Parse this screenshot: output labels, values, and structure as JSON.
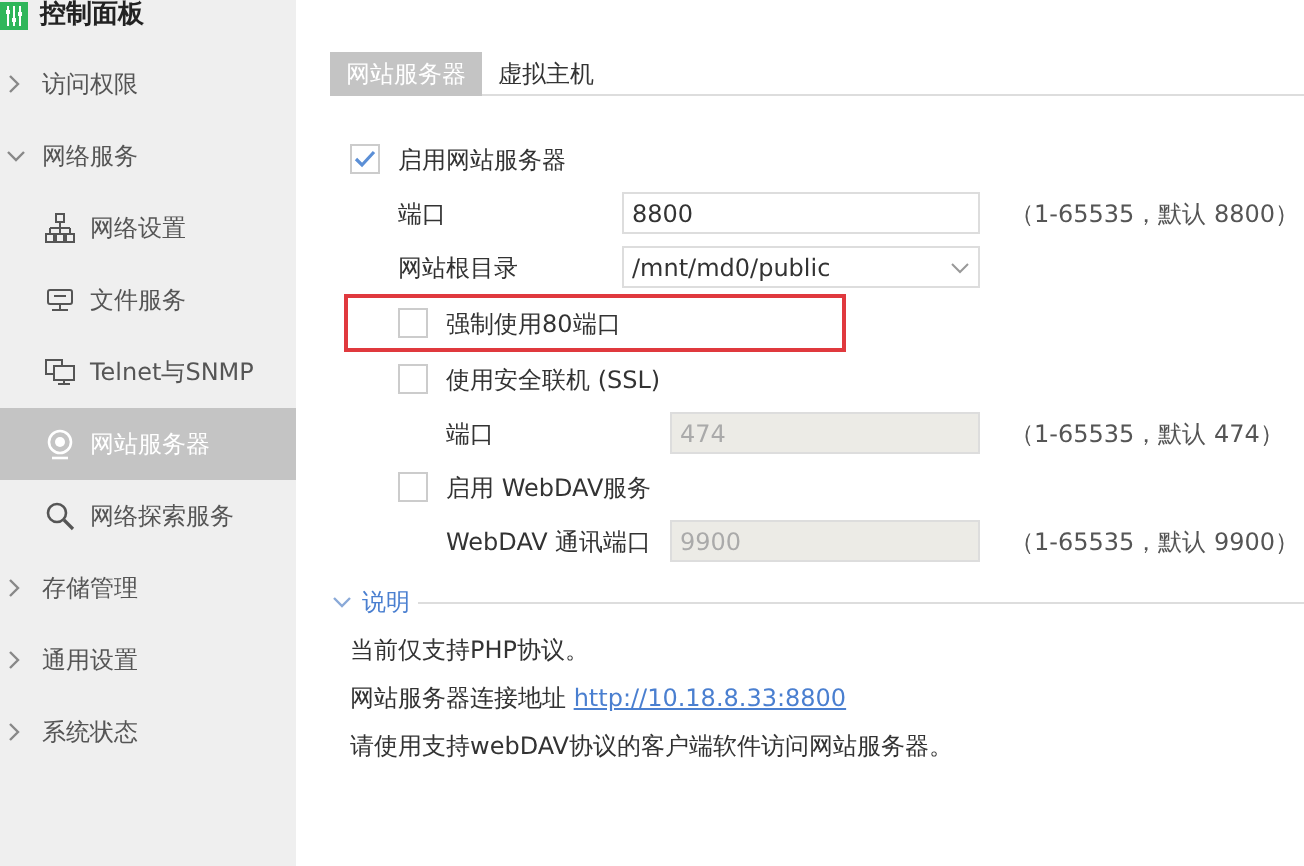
{
  "sidebar": {
    "title": "控制面板",
    "items": [
      {
        "label": "访问权限",
        "expanded": false
      },
      {
        "label": "网络服务",
        "expanded": true,
        "children": [
          {
            "label": "网络设置",
            "selected": false
          },
          {
            "label": "文件服务",
            "selected": false
          },
          {
            "label": "Telnet与SNMP",
            "selected": false
          },
          {
            "label": "网站服务器",
            "selected": true
          },
          {
            "label": "网络探索服务",
            "selected": false
          }
        ]
      },
      {
        "label": "存储管理",
        "expanded": false
      },
      {
        "label": "通用设置",
        "expanded": false
      },
      {
        "label": "系统状态",
        "expanded": false
      }
    ]
  },
  "tabs": [
    {
      "label": "网站服务器",
      "selected": true
    },
    {
      "label": "虚拟主机",
      "selected": false
    }
  ],
  "settings": [
    {
      "kind": "checkbox",
      "label": "启用网站服务器",
      "checked": true,
      "highlighted": false,
      "children": [
        {
          "kind": "field",
          "label": "端口",
          "value": "8800",
          "disabled": false,
          "hint": "（1-65535，默认 8800）"
        },
        {
          "kind": "select",
          "label": "网站根目录",
          "value": "/mnt/md0/public"
        },
        {
          "kind": "checkbox",
          "label": "强制使用80端口",
          "checked": false,
          "highlighted": true
        },
        {
          "kind": "checkbox",
          "label": "使用安全联机 (SSL)",
          "checked": false,
          "highlighted": false,
          "children": [
            {
              "kind": "field",
              "label": "端口",
              "value": "474",
              "disabled": true,
              "hint": "（1-65535，默认 474）"
            }
          ]
        },
        {
          "kind": "checkbox",
          "label": "启用 WebDAV服务",
          "checked": false,
          "highlighted": false,
          "children": [
            {
              "kind": "field",
              "label": "WebDAV 通讯端口",
              "value": "9900",
              "disabled": true,
              "hint": "（1-65535，默认 9900）"
            }
          ]
        }
      ]
    }
  ],
  "notes": {
    "title": "说明",
    "expanded": true,
    "lines": [
      {
        "text": "当前仅支持PHP协议。"
      },
      {
        "text": "网站服务器连接地址",
        "link": "http://10.18.8.33:8800"
      },
      {
        "text": "请使用支持webDAV协议的客户端软件访问网站服务器。"
      }
    ]
  }
}
